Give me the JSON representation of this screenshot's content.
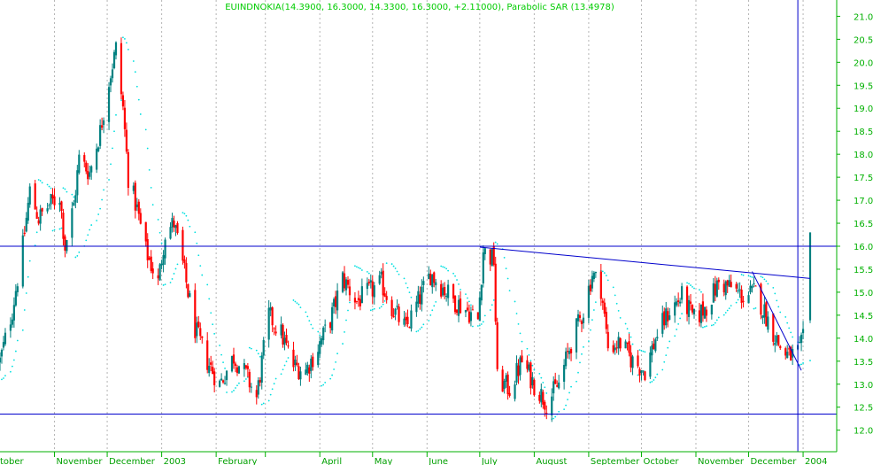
{
  "chart_data": {
    "type": "candlestick",
    "title": "EUINDNOKIA(14.3900, 16.3000, 14.3300, 16.3000, +2.11000), Parabolic SAR (13.4978)",
    "ylim": [
      11.6,
      21.3
    ],
    "y_ticks": [
      "12.0",
      "12.5",
      "13.0",
      "13.5",
      "14.0",
      "14.5",
      "15.0",
      "15.5",
      "16.0",
      "16.5",
      "17.0",
      "17.5",
      "18.0",
      "18.5",
      "19.0",
      "19.5",
      "20.0",
      "20.5",
      "21.0"
    ],
    "x_ticks": [
      "tober",
      "November",
      "December",
      "2003",
      "February",
      "April",
      "May",
      "June",
      "July",
      "August",
      "September",
      "October",
      "November",
      "December",
      "2004"
    ],
    "grid": true,
    "colors": {
      "up": "#008080",
      "down": "#ff0000",
      "sar": "#00e0e0",
      "lines": "#0000cc",
      "axis": "#00b000",
      "grid": "#b4b4b4"
    },
    "horizontal_levels": [
      16.0,
      12.35
    ],
    "trendlines": [
      {
        "from": [
          "2003-07-01",
          15.98
        ],
        "to": [
          "2004-01-05",
          15.3
        ]
      },
      {
        "from": [
          "2003-12-03",
          15.45
        ],
        "to": [
          "2003-12-31",
          13.3
        ]
      }
    ],
    "vertical_marker": "2003-12-29",
    "last_bar": {
      "open": 14.39,
      "high": 16.3,
      "low": 14.33,
      "close": 16.3,
      "change": 2.11
    },
    "sar_last": 13.4978,
    "price_anchors": [
      [
        "2002-10-01",
        13.5
      ],
      [
        "2002-10-08",
        14.6
      ],
      [
        "2002-10-14",
        16.0
      ],
      [
        "2002-10-18",
        17.2
      ],
      [
        "2002-10-23",
        16.6
      ],
      [
        "2002-10-29",
        16.9
      ],
      [
        "2002-11-04",
        17.1
      ],
      [
        "2002-11-07",
        16.0
      ],
      [
        "2002-11-12",
        16.9
      ],
      [
        "2002-11-15",
        17.9
      ],
      [
        "2002-11-21",
        17.6
      ],
      [
        "2002-11-27",
        18.5
      ],
      [
        "2002-12-02",
        19.6
      ],
      [
        "2002-12-06",
        20.3
      ],
      [
        "2002-12-10",
        19.0
      ],
      [
        "2002-12-13",
        17.5
      ],
      [
        "2002-12-18",
        16.8
      ],
      [
        "2002-12-23",
        15.9
      ],
      [
        "2002-12-30",
        15.2
      ],
      [
        "2003-01-03",
        16.3
      ],
      [
        "2003-01-08",
        16.5
      ],
      [
        "2003-01-13",
        15.6
      ],
      [
        "2003-01-20",
        14.2
      ],
      [
        "2003-01-27",
        13.5
      ],
      [
        "2003-02-03",
        13.0
      ],
      [
        "2003-02-11",
        13.6
      ],
      [
        "2003-02-18",
        13.2
      ],
      [
        "2003-02-24",
        12.7
      ],
      [
        "2003-03-03",
        14.5
      ],
      [
        "2003-03-10",
        14.1
      ],
      [
        "2003-03-17",
        13.4
      ],
      [
        "2003-03-24",
        13.3
      ],
      [
        "2003-03-31",
        13.8
      ],
      [
        "2003-04-07",
        14.4
      ],
      [
        "2003-04-14",
        15.3
      ],
      [
        "2003-04-22",
        14.8
      ],
      [
        "2003-04-29",
        15.0
      ],
      [
        "2003-05-06",
        15.2
      ],
      [
        "2003-05-13",
        14.6
      ],
      [
        "2003-05-20",
        14.2
      ],
      [
        "2003-05-27",
        14.8
      ],
      [
        "2003-06-03",
        15.4
      ],
      [
        "2003-06-10",
        15.1
      ],
      [
        "2003-06-17",
        14.8
      ],
      [
        "2003-06-24",
        14.6
      ],
      [
        "2003-06-30",
        14.4
      ],
      [
        "2003-07-03",
        15.9
      ],
      [
        "2003-07-09",
        15.7
      ],
      [
        "2003-07-11",
        13.1
      ],
      [
        "2003-07-18",
        12.9
      ],
      [
        "2003-07-25",
        13.5
      ],
      [
        "2003-08-01",
        13.0
      ],
      [
        "2003-08-08",
        12.6
      ],
      [
        "2003-08-15",
        13.0
      ],
      [
        "2003-08-22",
        13.9
      ],
      [
        "2003-08-29",
        14.6
      ],
      [
        "2003-09-03",
        15.4
      ],
      [
        "2003-09-08",
        15.1
      ],
      [
        "2003-09-12",
        13.8
      ],
      [
        "2003-09-19",
        13.9
      ],
      [
        "2003-09-26",
        13.5
      ],
      [
        "2003-10-03",
        13.3
      ],
      [
        "2003-10-10",
        14.1
      ],
      [
        "2003-10-17",
        14.6
      ],
      [
        "2003-10-24",
        14.9
      ],
      [
        "2003-10-31",
        14.4
      ],
      [
        "2003-11-07",
        14.7
      ],
      [
        "2003-11-14",
        15.2
      ],
      [
        "2003-11-21",
        15.1
      ],
      [
        "2003-11-28",
        14.9
      ],
      [
        "2003-12-05",
        15.0
      ],
      [
        "2003-12-12",
        14.4
      ],
      [
        "2003-12-19",
        13.8
      ],
      [
        "2003-12-24",
        13.6
      ],
      [
        "2003-12-30",
        13.7
      ],
      [
        "2004-01-02",
        14.1
      ]
    ]
  }
}
